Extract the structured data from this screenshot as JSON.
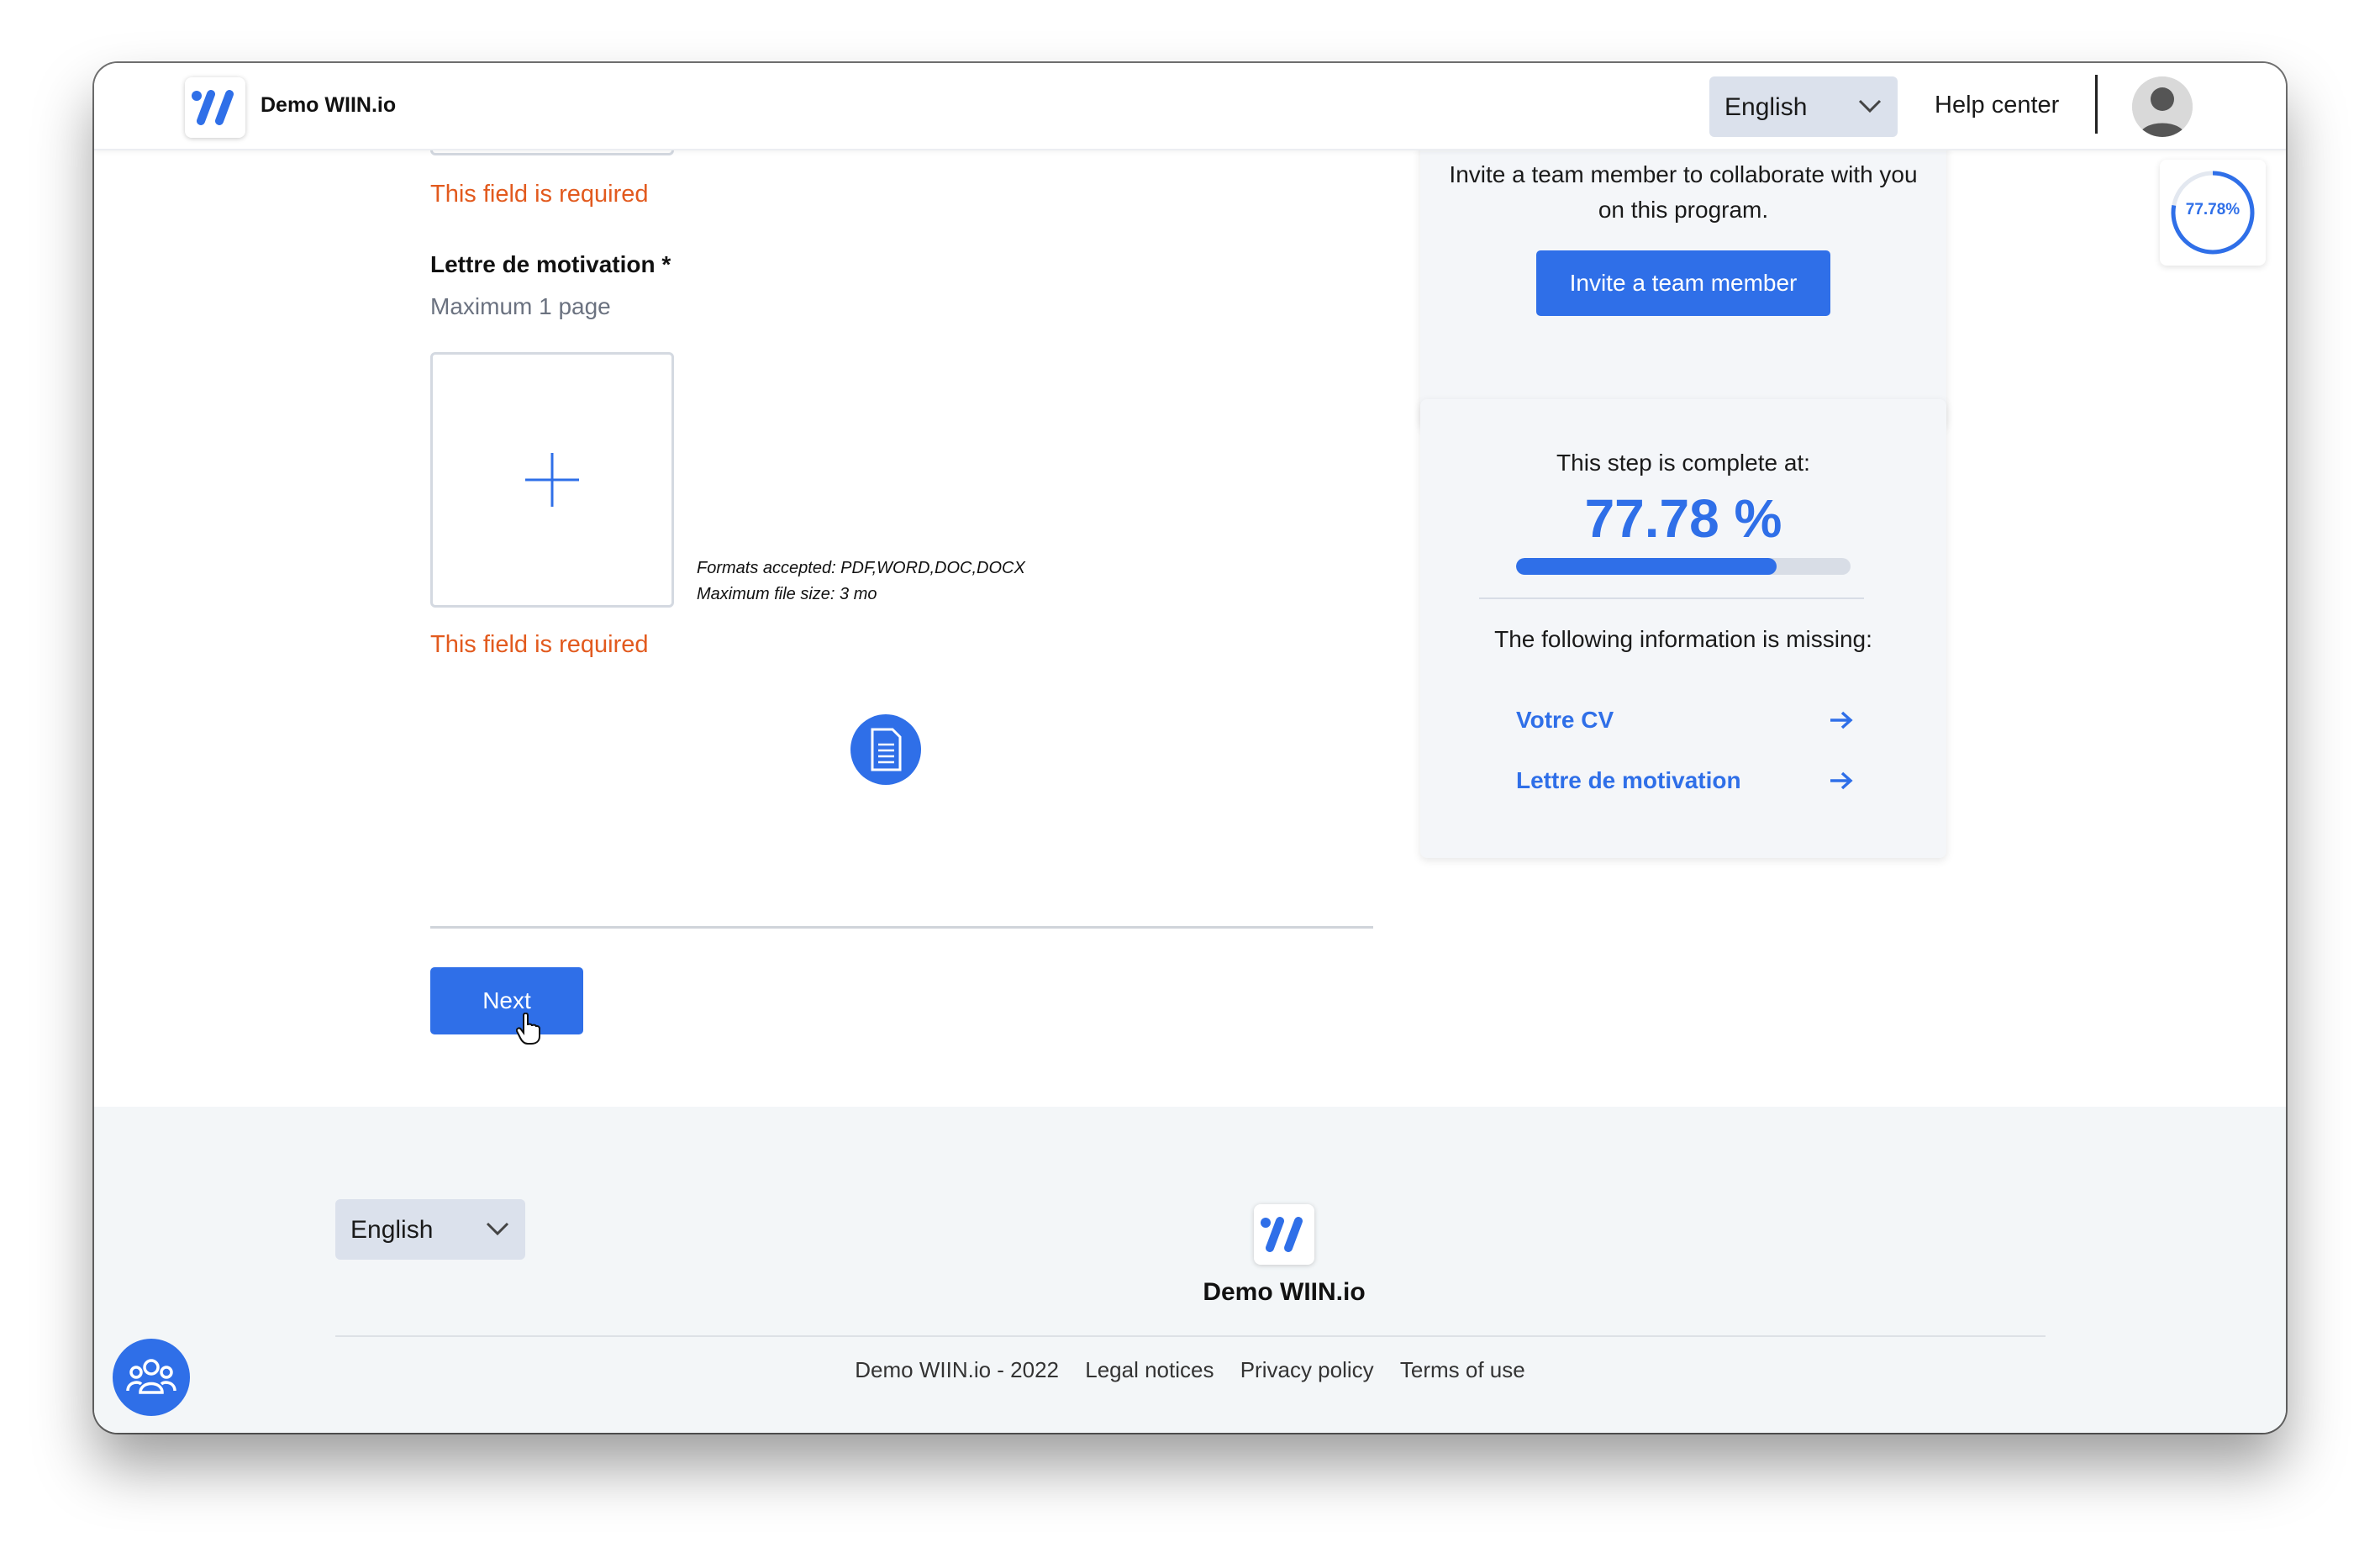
{
  "header": {
    "brand": "Demo WIIN.io",
    "language": "English",
    "help_center": "Help center",
    "mini_progress": "77.78%"
  },
  "form": {
    "error_required": "This field is required",
    "cover_letter": {
      "label": "Lettre de motivation *",
      "hint": "Maximum 1 page",
      "formats": "Formats accepted: PDF,WORD,DOC,DOCX",
      "max_size": "Maximum file size: 3 mo"
    },
    "next_label": "Next"
  },
  "invite_card": {
    "text": "Invite a team member to collaborate with you on this program.",
    "button": "Invite a team member"
  },
  "progress_card": {
    "title": "This step is complete at:",
    "percent": "77.78 %",
    "progress_fraction": 0.7778,
    "missing_title": "The following information is missing:",
    "missing_items": [
      "Votre CV",
      "Lettre de motivation"
    ]
  },
  "footer": {
    "language": "English",
    "brand": "Demo WIIN.io",
    "links": [
      "Demo WIIN.io - 2022",
      "Legal notices",
      "Privacy policy",
      "Terms of use"
    ]
  },
  "colors": {
    "accent": "#2f6fe8",
    "error": "#e25a1e"
  }
}
